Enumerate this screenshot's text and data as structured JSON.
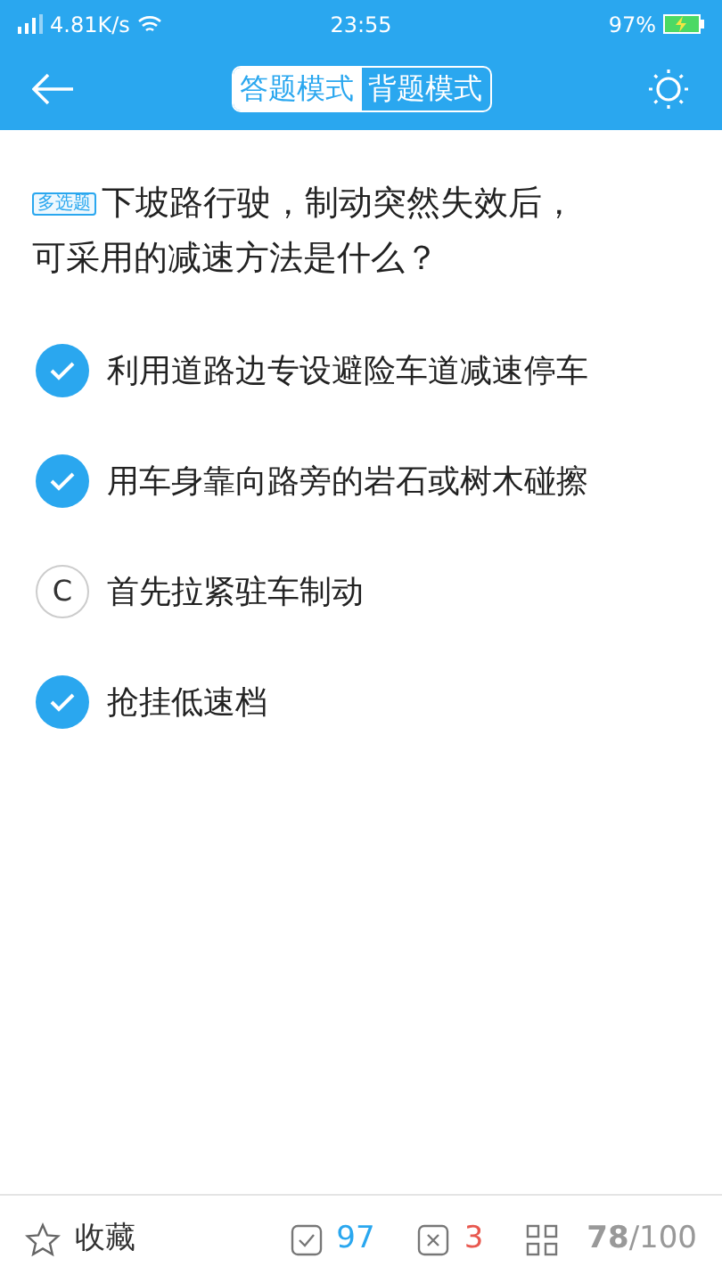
{
  "status_bar": {
    "network_speed": "4.81K/s",
    "time": "23:55",
    "battery": "97%"
  },
  "header": {
    "modes": [
      {
        "label": "答题模式",
        "selected": true
      },
      {
        "label": "背题模式",
        "selected": false
      }
    ]
  },
  "question": {
    "tag": "多选题",
    "lines": [
      "下坡路行驶，制动突然失效后，",
      "可采用的减速方法是什么？"
    ]
  },
  "options": [
    {
      "text": "利用道路边专设避险车道减速停车",
      "selected": true
    },
    {
      "text": "用车身靠向路旁的岩石或树木碰擦",
      "selected": true
    },
    {
      "letter": "C",
      "text": "首先拉紧驻车制动",
      "selected": false
    },
    {
      "text": "抢挂低速档",
      "selected": true
    }
  ],
  "footer": {
    "favorite": "收藏",
    "correct": "97",
    "wrong": "3",
    "progress": "**78**/100"
  }
}
